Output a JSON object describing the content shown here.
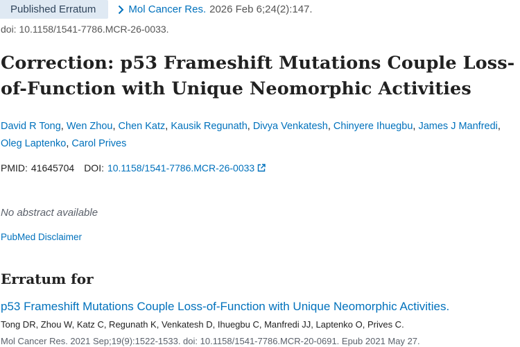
{
  "badge": "Published Erratum",
  "journal_link": "Mol Cancer Res.",
  "citation": "2026 Feb 6;24(2):147.",
  "doi_line": "doi: 10.1158/1541-7786.MCR-26-0033.",
  "title": "Correction: p53 Frameshift Mutations Couple Loss-of-Function with Unique Neomorphic Activities",
  "authors": [
    "David R Tong",
    "Wen Zhou",
    "Chen Katz",
    "Kausik Regunath",
    "Divya Venkatesh",
    "Chinyere Ihuegbu",
    "James J Manfredi",
    "Oleg Laptenko",
    "Carol Prives"
  ],
  "identifiers": {
    "pmid_label": "PMID:",
    "pmid": "41645704",
    "doi_label": "DOI:",
    "doi": "10.1158/1541-7786.MCR-26-0033"
  },
  "no_abstract": "No abstract available",
  "disclaimer": "PubMed Disclaimer",
  "erratum_for": {
    "heading": "Erratum for",
    "title": "p53 Frameshift Mutations Couple Loss-of-Function with Unique Neomorphic Activities.",
    "authors": "Tong DR, Zhou W, Katz C, Regunath K, Venkatesh D, Ihuegbu C, Manfredi JJ, Laptenko O, Prives C.",
    "citation": "Mol Cancer Res. 2021 Sep;19(9):1522-1533. doi: 10.1158/1541-7786.MCR-20-0691. Epub 2021 May 27."
  },
  "colors": {
    "link": "#0071bc",
    "badge_bg": "#dfe9f3",
    "text": "#212121",
    "muted": "#5b616b"
  },
  "icons": {
    "journal_chevron": "chevron-right-icon",
    "external_link": "external-link-icon"
  }
}
